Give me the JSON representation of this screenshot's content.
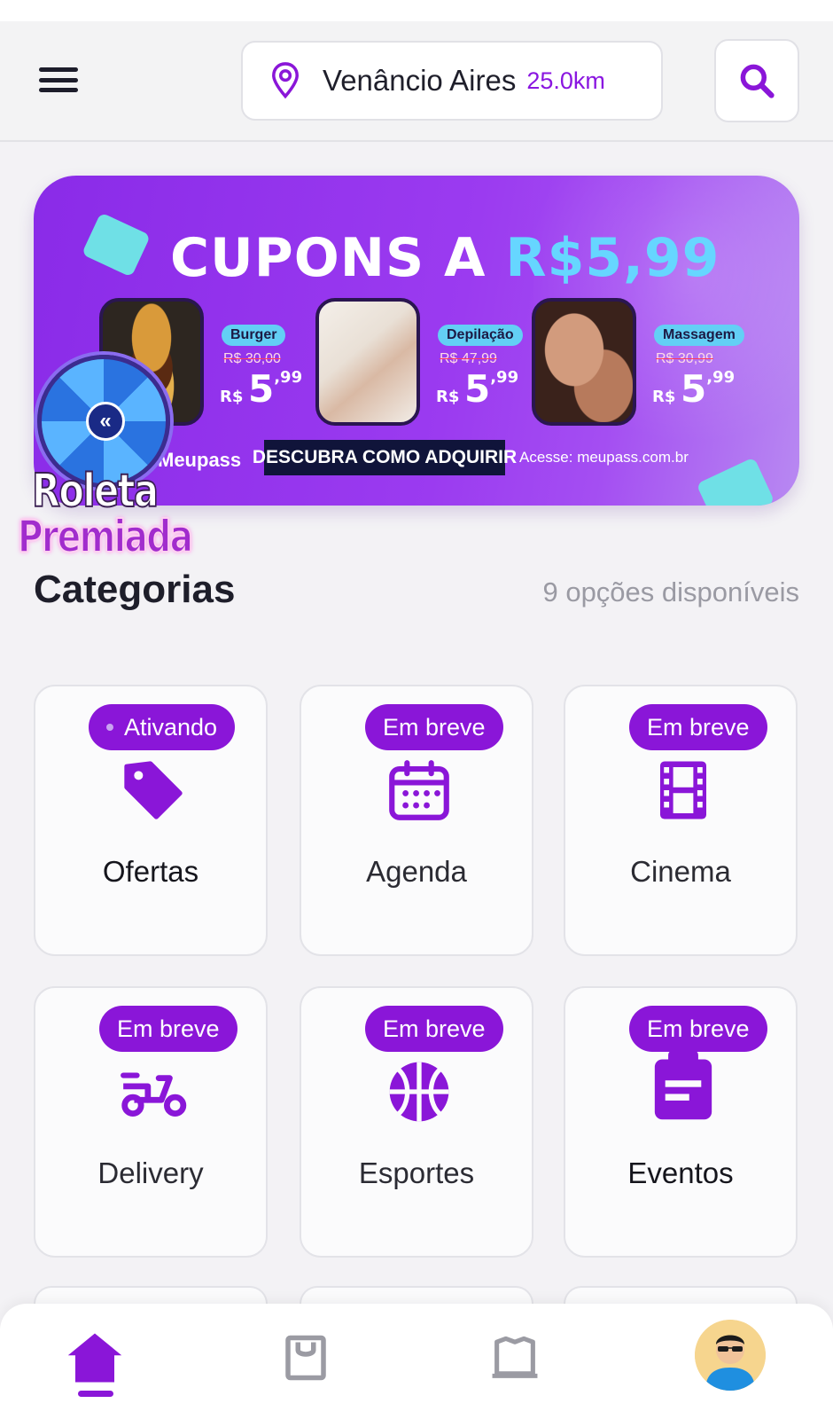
{
  "header": {
    "location_city": "Venâncio Aires",
    "location_distance": "25.0km"
  },
  "banner": {
    "title_main": "CUPONS A ",
    "title_price": "R$5,99",
    "offers": [
      {
        "tag": "Burger",
        "old_price": "R$ 30,00",
        "currency": "R$",
        "price_int": "5",
        "price_dec": ",99"
      },
      {
        "tag": "Depilação",
        "old_price": "R$ 47,99",
        "currency": "R$",
        "price_int": "5",
        "price_dec": ",99"
      },
      {
        "tag": "Massagem",
        "old_price": "R$ 30,99",
        "currency": "R$",
        "price_int": "5",
        "price_dec": ",99"
      }
    ],
    "brand": "Meupass",
    "cta": "DESCUBRA COMO ADQUIRIR",
    "access": "Acesse: meupass.com.br"
  },
  "roleta": {
    "line1": "Roleta",
    "line2": "Premiada"
  },
  "categories": {
    "title": "Categorias",
    "count_text": "9 opções disponíveis",
    "items": [
      {
        "label": "Ofertas",
        "badge": "Ativando",
        "icon": "tag-icon"
      },
      {
        "label": "Agenda",
        "badge": "Em breve",
        "icon": "calendar-icon"
      },
      {
        "label": "Cinema",
        "badge": "Em breve",
        "icon": "film-icon"
      },
      {
        "label": "Delivery",
        "badge": "Em breve",
        "icon": "scooter-icon"
      },
      {
        "label": "Esportes",
        "badge": "Em breve",
        "icon": "basketball-icon"
      },
      {
        "label": "Eventos",
        "badge": "Em breve",
        "icon": "event-clipboard-icon"
      }
    ]
  },
  "bottom_nav": {
    "items": [
      {
        "name": "home",
        "icon": "home-icon",
        "active": true
      },
      {
        "name": "shop",
        "icon": "shopping-bag-icon",
        "active": false
      },
      {
        "name": "tickets",
        "icon": "ticket-icon",
        "active": false
      },
      {
        "name": "profile",
        "icon": "avatar",
        "active": false
      }
    ]
  },
  "colors": {
    "accent": "#8a16d8",
    "banner_start": "#8a2be8",
    "price_highlight": "#66d6ff"
  }
}
